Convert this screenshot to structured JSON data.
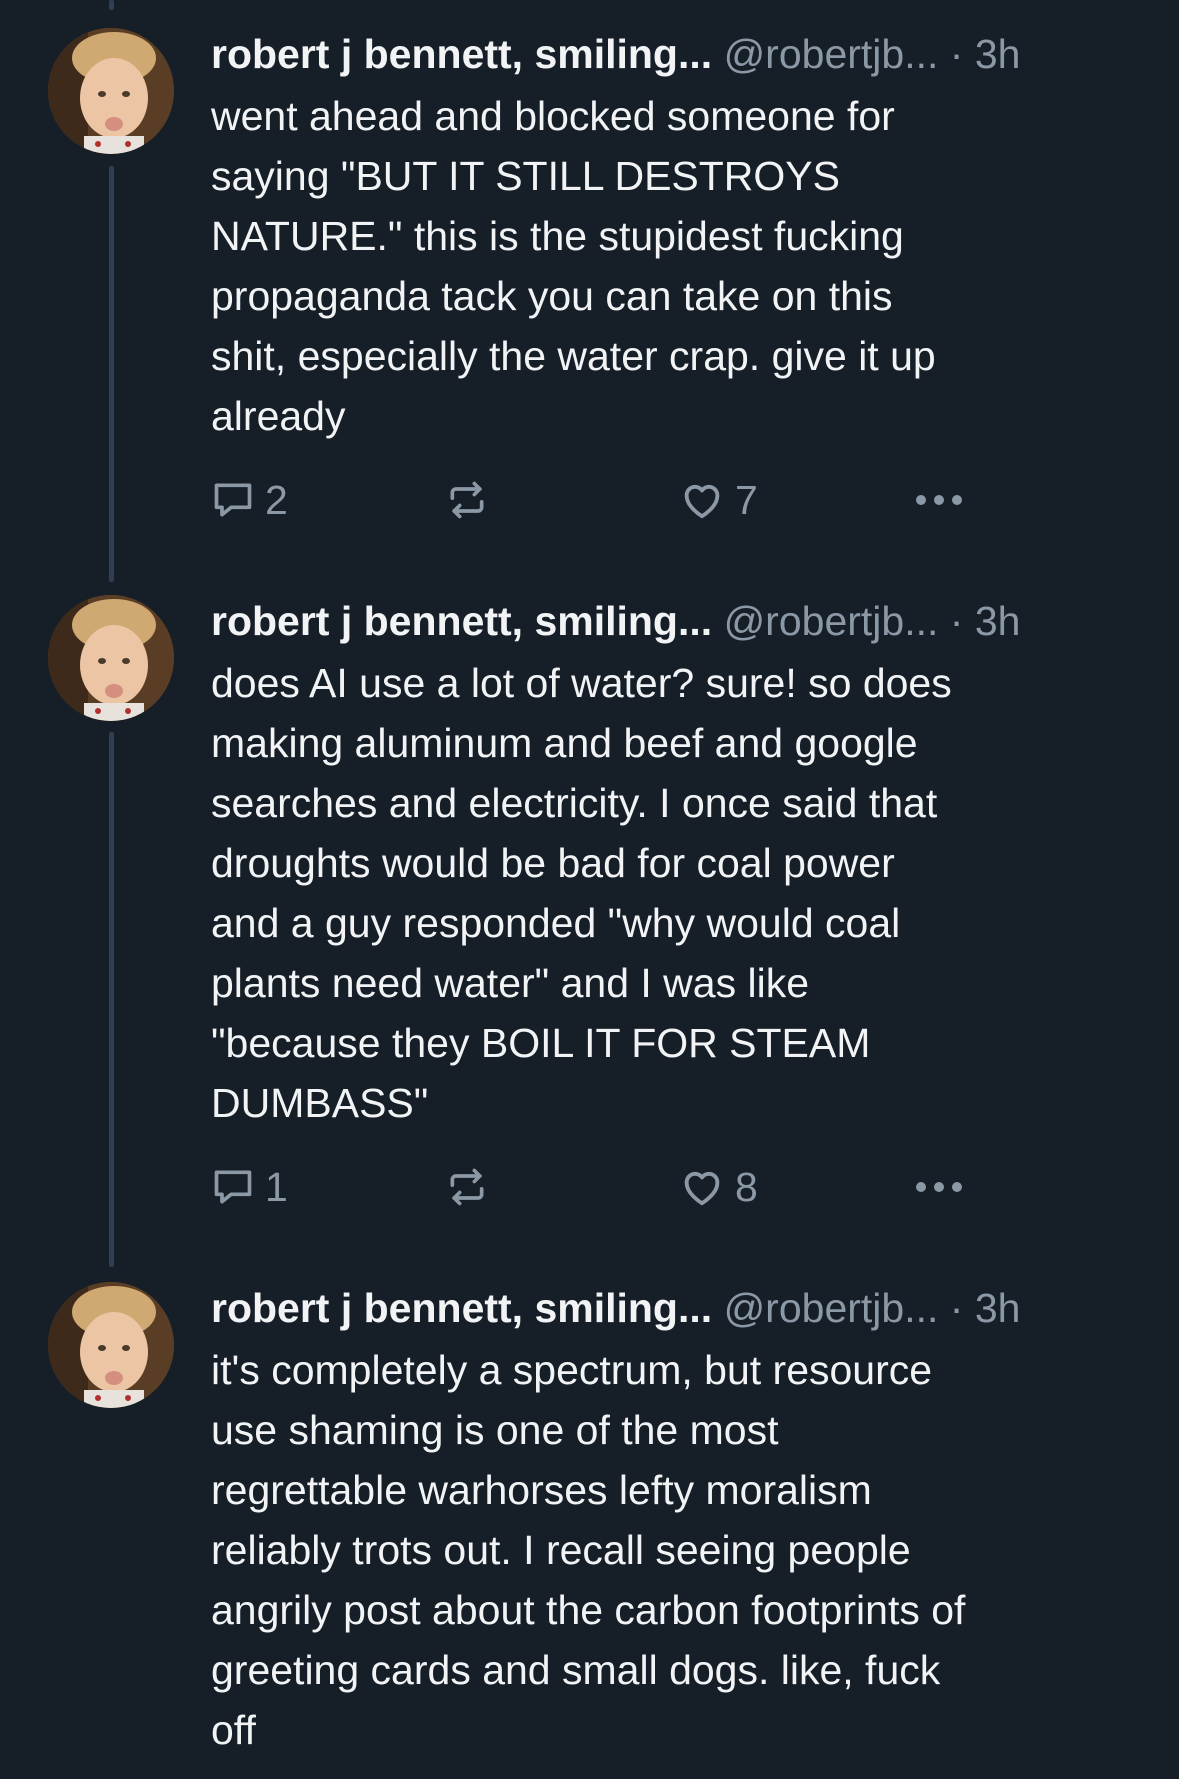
{
  "colors": {
    "background": "#161e27",
    "text": "#f1f3f5",
    "muted": "#8b98a5",
    "thread_line": "#2e4052"
  },
  "posts": [
    {
      "display_name": "robert j bennett, smiling...",
      "handle": "@robertjb...",
      "separator": "·",
      "time": "3h",
      "text": "went ahead and blocked someone for\nsaying \"BUT IT STILL DESTROYS\nNATURE.\" this is the stupidest fucking\npropaganda tack you can take on this\nshit, especially the water crap. give it up\nalready",
      "reply_count": "2",
      "like_count": "7",
      "icons": [
        "reply-icon",
        "repost-icon",
        "heart-icon",
        "more-icon"
      ]
    },
    {
      "display_name": "robert j bennett, smiling...",
      "handle": "@robertjb...",
      "separator": "·",
      "time": "3h",
      "text": "does AI use a lot of water? sure! so does\nmaking aluminum and beef and google\nsearches and electricity. I once said that\ndroughts would be bad for coal power\nand a guy responded \"why would coal\nplants need water\" and I was like\n\"because they BOIL IT FOR STEAM\nDUMBASS\"",
      "reply_count": "1",
      "like_count": "8",
      "icons": [
        "reply-icon",
        "repost-icon",
        "heart-icon",
        "more-icon"
      ]
    },
    {
      "display_name": "robert j bennett, smiling...",
      "handle": "@robertjb...",
      "separator": "·",
      "time": "3h",
      "text": "it's completely a spectrum, but resource\nuse shaming is one of the most\nregrettable warhorses lefty moralism\nreliably trots out. I recall seeing people\nangrily post about the carbon footprints of\ngreeting cards and small dogs. like, fuck\noff"
    }
  ]
}
